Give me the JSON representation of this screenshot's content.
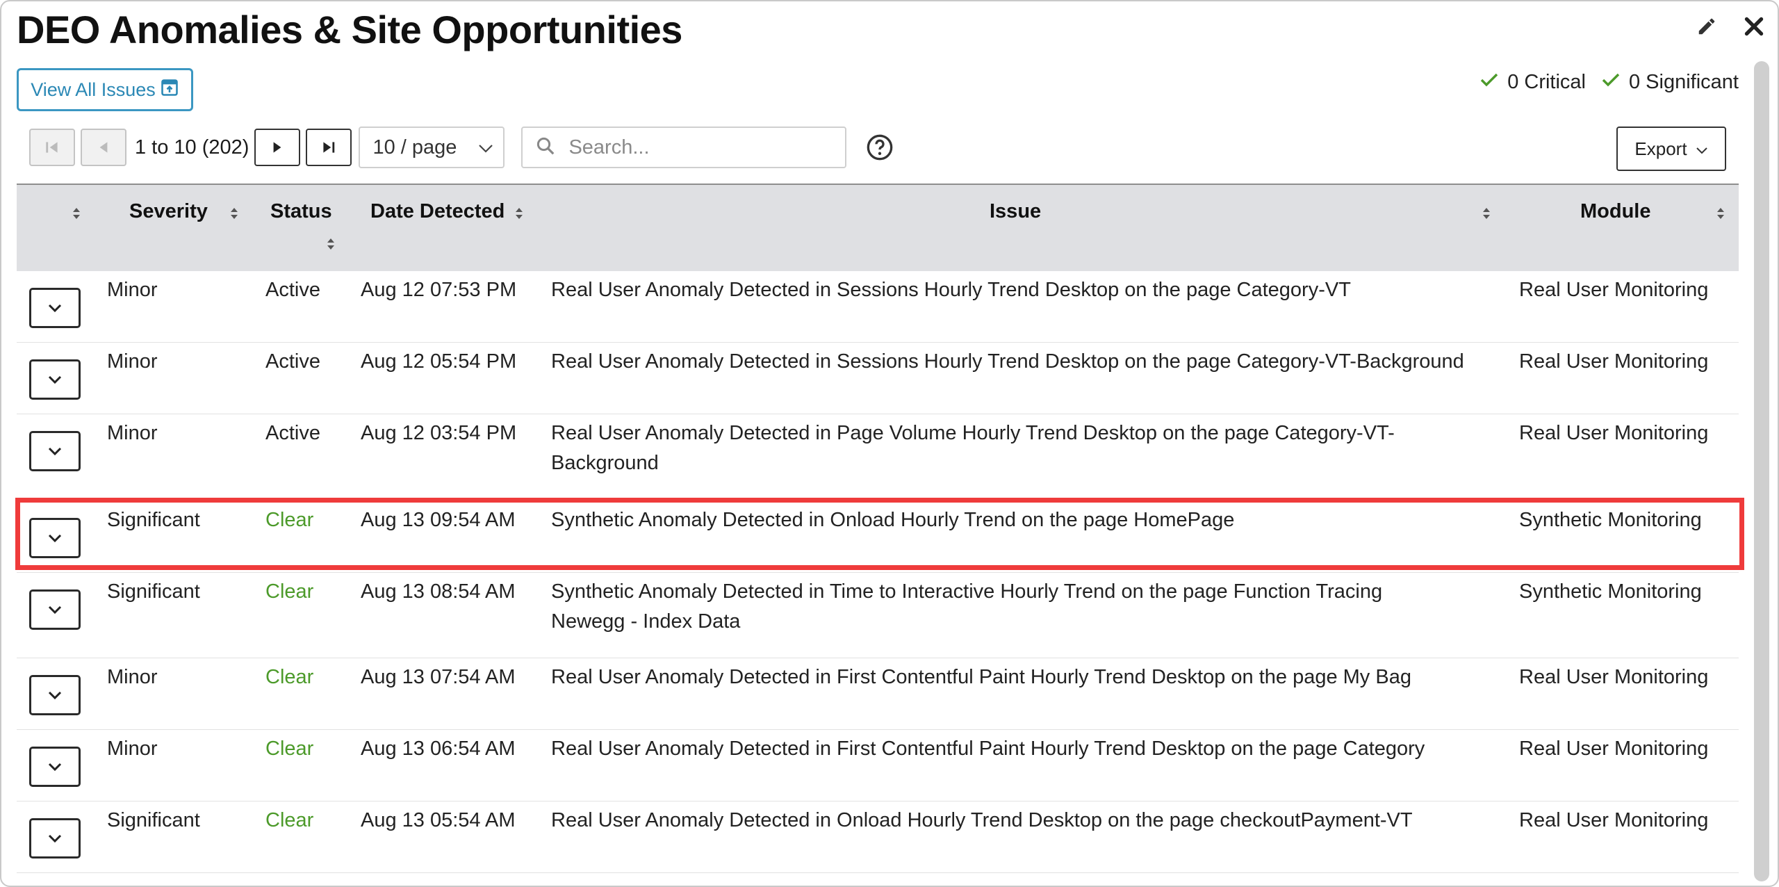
{
  "widget": {
    "title": "DEO Anomalies & Site Opportunities",
    "edit_icon": "pencil-icon",
    "close_icon": "close-icon"
  },
  "toolbar": {
    "view_all_label": "View All Issues",
    "summary": {
      "critical": "0 Critical",
      "significant": "0 Significant",
      "ok_color": "#4c9a2a"
    },
    "range_text": "1 to 10 (202)",
    "per_page": "10 / page",
    "search_placeholder": "Search...",
    "export_label": "Export"
  },
  "table": {
    "headers": {
      "severity": "Severity",
      "status": "Status",
      "date": "Date Detected",
      "issue": "Issue",
      "module": "Module"
    },
    "rows": [
      {
        "severity": "Minor",
        "status": "Active",
        "date": "Aug 12 07:53 PM",
        "issue": "Real User Anomaly Detected in Sessions Hourly Trend Desktop on the page Category-VT",
        "module": "Real User Monitoring"
      },
      {
        "severity": "Minor",
        "status": "Active",
        "date": "Aug 12 05:54 PM",
        "issue": "Real User Anomaly Detected in Sessions Hourly Trend Desktop on the page Category-VT-Background",
        "module": "Real User Monitoring"
      },
      {
        "severity": "Minor",
        "status": "Active",
        "date": "Aug 12 03:54 PM",
        "issue": "Real User Anomaly Detected in Page Volume Hourly Trend Desktop on the page Category-VT-Background",
        "module": "Real User Monitoring"
      },
      {
        "severity": "Significant",
        "status": "Clear",
        "date": "Aug 13 09:54 AM",
        "issue": "Synthetic Anomaly Detected in Onload Hourly Trend on the page HomePage",
        "module": "Synthetic Monitoring"
      },
      {
        "severity": "Significant",
        "status": "Clear",
        "date": "Aug 13 08:54 AM",
        "issue": "Synthetic Anomaly Detected in Time to Interactive Hourly Trend on the page Function Tracing Newegg - Index Data",
        "module": "Synthetic Monitoring"
      },
      {
        "severity": "Minor",
        "status": "Clear",
        "date": "Aug 13 07:54 AM",
        "issue": "Real User Anomaly Detected in First Contentful Paint Hourly Trend Desktop on the page My Bag",
        "module": "Real User Monitoring"
      },
      {
        "severity": "Minor",
        "status": "Clear",
        "date": "Aug 13 06:54 AM",
        "issue": "Real User Anomaly Detected in First Contentful Paint Hourly Trend Desktop on the page Category",
        "module": "Real User Monitoring"
      },
      {
        "severity": "Significant",
        "status": "Clear",
        "date": "Aug 13 05:54 AM",
        "issue": "Real User Anomaly Detected in Onload Hourly Trend Desktop on the page checkoutPayment-VT",
        "module": "Real User Monitoring"
      }
    ]
  },
  "colors": {
    "highlight": "#ef3b3b",
    "clear_status": "#4c9a2a",
    "link": "#2b88b5"
  }
}
